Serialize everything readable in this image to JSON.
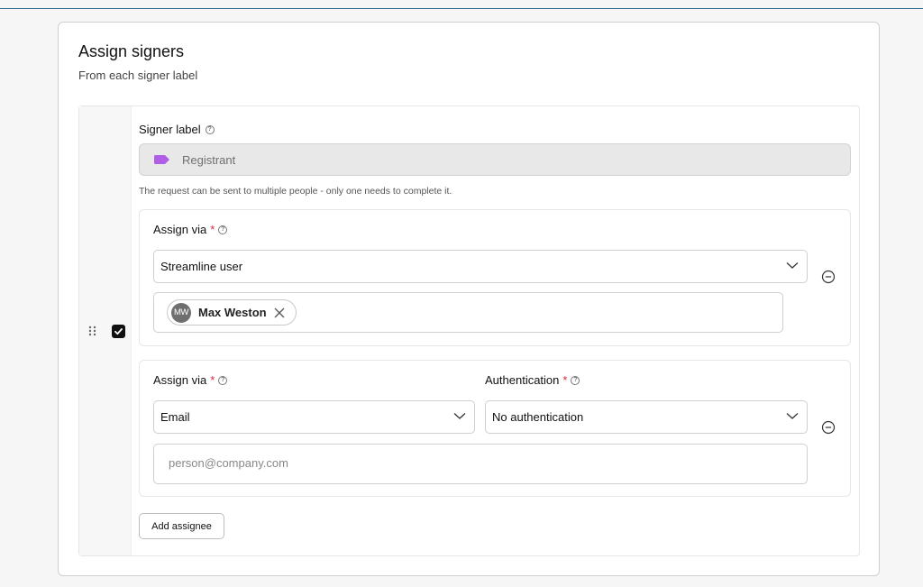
{
  "card": {
    "title": "Assign signers",
    "subtitle": "From each signer label"
  },
  "signer": {
    "checked": true,
    "label_title": "Signer label",
    "label_value": "Registrant",
    "label_color": "#b05ee6",
    "hint": "The request can be sent to multiple people - only one needs to complete it.",
    "assignees": [
      {
        "assign_via_label": "Assign via",
        "required_mark": "*",
        "assign_via_value": "Streamline user",
        "chip": {
          "initials": "MW",
          "name": "Max Weston"
        }
      },
      {
        "assign_via_label": "Assign via",
        "required_mark": "*",
        "assign_via_value": "Email",
        "auth_label": "Authentication",
        "auth_value": "No authentication",
        "email_placeholder": "person@company.com"
      }
    ],
    "add_button": "Add assignee"
  },
  "colors": {
    "required": "#d0303a",
    "accent_rule": "#2e6b8c"
  }
}
